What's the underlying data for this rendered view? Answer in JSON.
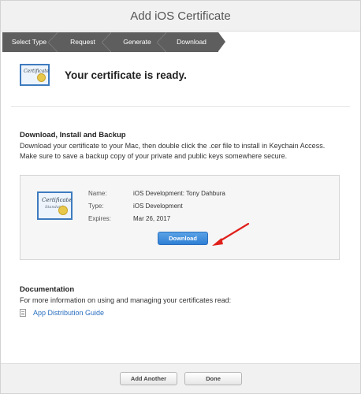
{
  "window": {
    "title": "Add iOS Certificate"
  },
  "steps": [
    {
      "label": "Select Type"
    },
    {
      "label": "Request"
    },
    {
      "label": "Generate"
    },
    {
      "label": "Download"
    }
  ],
  "ready": {
    "title": "Your certificate is ready.",
    "icon_text": "Certificate"
  },
  "download_section": {
    "title": "Download, Install and Backup",
    "text": "Download your certificate to your Mac, then double click the .cer file to install in Keychain Access. Make sure to save a backup copy of your private and public keys somewhere secure."
  },
  "certificate": {
    "icon_text": "Certificate",
    "icon_sub": "Standard",
    "name_label": "Name:",
    "name_value": "iOS Development: Tony Dahbura",
    "type_label": "Type:",
    "type_value": "iOS Development",
    "expires_label": "Expires:",
    "expires_value": "Mar 26, 2017",
    "download_label": "Download"
  },
  "documentation": {
    "title": "Documentation",
    "text": "For more information on using and managing your certificates read:",
    "link_label": "App Distribution Guide"
  },
  "footer": {
    "add_another_label": "Add Another",
    "done_label": "Done"
  },
  "colors": {
    "accent": "#2f7fd4",
    "arrow": "#e0201b",
    "step_bar": "#5e5e5e"
  },
  "icons": [
    "certificate-icon",
    "document-icon",
    "red-arrow-annotation"
  ]
}
